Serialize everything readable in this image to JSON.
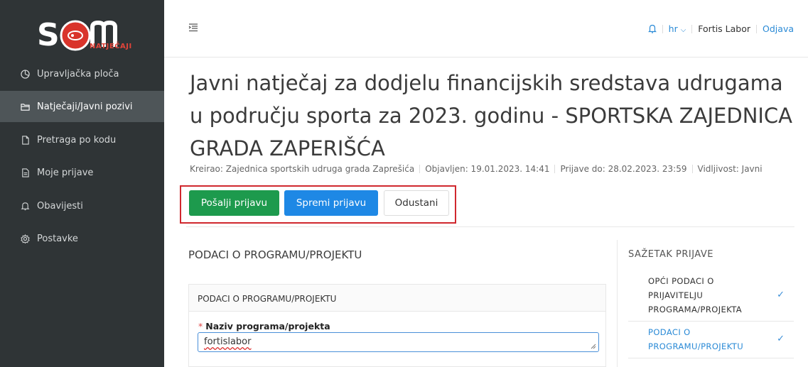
{
  "brand": {
    "logo_text": "S",
    "logo_sub": "NATJEČAJI",
    "accent": "#d9342b"
  },
  "sidebar": {
    "items": [
      {
        "label": "Upravljačka ploča",
        "icon": "dashboard-icon"
      },
      {
        "label": "Natječaji/Javni pozivi",
        "icon": "folder-icon",
        "active": true
      },
      {
        "label": "Pretraga po kodu",
        "icon": "document-icon"
      },
      {
        "label": "Moje prijave",
        "icon": "document-list-icon"
      },
      {
        "label": "Obavijesti",
        "icon": "bell-icon"
      },
      {
        "label": "Postavke",
        "icon": "gear-icon"
      }
    ]
  },
  "header": {
    "lang": "hr",
    "user": "Fortis Labor",
    "logout": "Odjava"
  },
  "page": {
    "title": "Javni natječaj za dodjelu financijskih sredstava udrugama u području sporta za 2023. godinu - SPORTSKA ZAJEDNICA GRADA ZAPERIŠĆA",
    "meta": {
      "created_by": "Kreirao: Zajednica sportskih udruga grada Zaprešića",
      "published": "Objavljen: 19.01.2023. 14:41",
      "deadline": "Prijave do: 28.02.2023. 23:59",
      "visibility": "Vidljivost: Javni"
    }
  },
  "actions": {
    "send": "Pošalji prijavu",
    "save": "Spremi prijavu",
    "cancel": "Odustani"
  },
  "form": {
    "section_title": "PODACI O PROGRAMU/PROJEKTU",
    "card_title": "PODACI O PROGRAMU/PROJEKTU",
    "required_mark": "*",
    "field_label": "Naziv programa/projekta",
    "field_value": "fortislabor"
  },
  "summary": {
    "title": "SAŽETAK PRIJAVE",
    "items": [
      {
        "label": "OPĆI PODACI O PRIJAVITELJU PROGRAMA/PROJEKTA",
        "lines": [
          "OPĆI PODACI O",
          "PRIJAVITELJU",
          "PROGRAMA/PROJEKTA"
        ],
        "checked": true,
        "color": "#333333"
      },
      {
        "label": "PODACI O PROGRAMU/PROJEKTU",
        "lines": [
          "PODACI O",
          "PROGRAMU/PROJEKTU"
        ],
        "checked": true,
        "color": "#2a8ad6"
      }
    ],
    "check": "✓"
  }
}
